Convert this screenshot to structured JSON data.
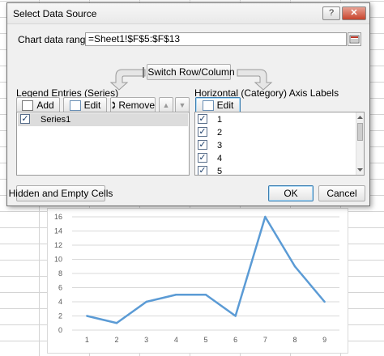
{
  "dialog": {
    "title": "Select Data Source",
    "help_label": "?",
    "close_label": "✕",
    "range_label": "Chart data range:",
    "range_value": "=Sheet1!$F$5:$F$13",
    "switch_label": "Switch Row/Column",
    "legend": {
      "heading": "Legend Entries (Series)",
      "add_label": "Add",
      "edit_label": "Edit",
      "remove_label": "Remove",
      "up_label": "▲",
      "down_label": "▼",
      "items": [
        {
          "label": "Series1",
          "checked": true
        }
      ]
    },
    "axis": {
      "heading": "Horizontal (Category) Axis Labels",
      "edit_label": "Edit",
      "items": [
        {
          "label": "1",
          "checked": true
        },
        {
          "label": "2",
          "checked": true
        },
        {
          "label": "3",
          "checked": true
        },
        {
          "label": "4",
          "checked": true
        },
        {
          "label": "5",
          "checked": true
        }
      ]
    },
    "hidden_cells_label": "Hidden and Empty Cells",
    "ok_label": "OK",
    "cancel_label": "Cancel"
  },
  "chart_data": {
    "type": "line",
    "categories": [
      "1",
      "2",
      "3",
      "4",
      "5",
      "6",
      "7",
      "8",
      "9"
    ],
    "series": [
      {
        "values": [
          2,
          1,
          4,
          5,
          5,
          2,
          16,
          9,
          4
        ]
      }
    ],
    "y_ticks": [
      "0",
      "2",
      "4",
      "6",
      "8",
      "10",
      "12",
      "14",
      "16"
    ],
    "ylim": [
      0,
      16
    ],
    "grid": true,
    "line_color": "#5b9bd5"
  }
}
